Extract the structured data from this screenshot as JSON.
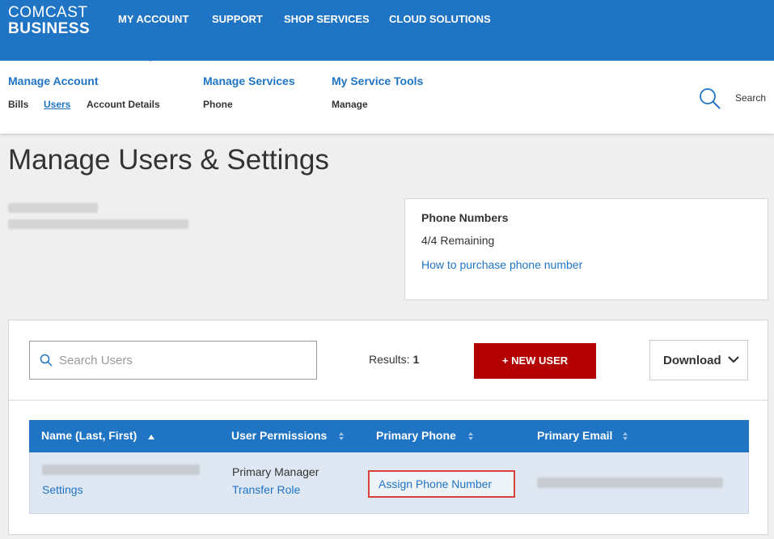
{
  "brand": {
    "line1": "COMCAST",
    "line2": "BUSINESS"
  },
  "top_nav": [
    "MY ACCOUNT",
    "SUPPORT",
    "SHOP SERVICES",
    "CLOUD SOLUTIONS"
  ],
  "sub_nav": {
    "manage_account": {
      "title": "Manage Account",
      "links": [
        "Bills",
        "Users",
        "Account Details"
      ],
      "active": "Users"
    },
    "manage_services": {
      "title": "Manage Services",
      "links": [
        "Phone"
      ]
    },
    "my_service_tools": {
      "title": "My Service Tools",
      "links": [
        "Manage"
      ]
    },
    "search_label": "Search"
  },
  "page_title": "Manage Users & Settings",
  "phone_card": {
    "title": "Phone Numbers",
    "remaining": "4/4 Remaining",
    "link": "How to purchase phone number"
  },
  "users": {
    "search_placeholder": "Search Users",
    "results_label": "Results:",
    "results_count": "1",
    "new_user_label": "+ NEW USER",
    "download_label": "Download",
    "columns": [
      "Name (Last, First)",
      "User Permissions",
      "Primary Phone",
      "Primary Email"
    ],
    "rows": [
      {
        "settings_link": "Settings",
        "permission": "Primary Manager",
        "transfer_link": "Transfer Role",
        "assign_phone": "Assign Phone Number"
      }
    ]
  },
  "colors": {
    "brand_blue": "#1f74c4",
    "new_user_red": "#b30000",
    "highlight_red": "#d9413b"
  },
  "icons": [
    "search-icon",
    "chevron-down-icon",
    "sort-icon",
    "caret-indicator"
  ]
}
